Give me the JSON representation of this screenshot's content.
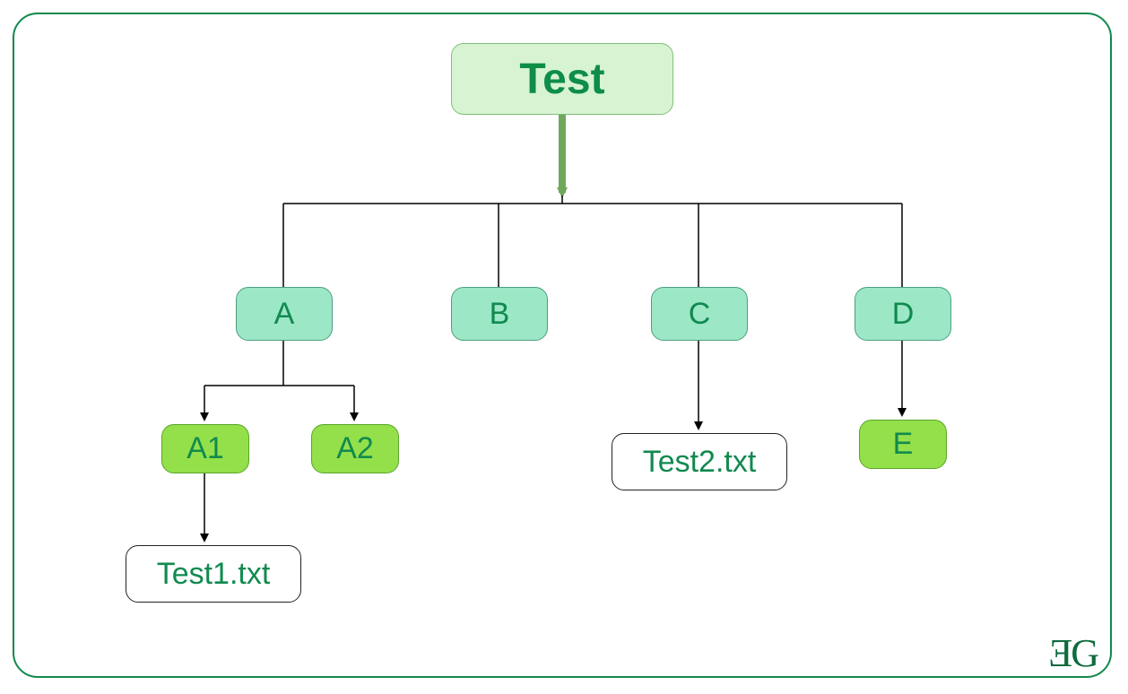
{
  "root": {
    "label": "Test"
  },
  "folders": {
    "a": "A",
    "b": "B",
    "c": "C",
    "d": "D"
  },
  "subfolders": {
    "a1": "A1",
    "a2": "A2",
    "e": "E"
  },
  "files": {
    "t1": "Test1.txt",
    "t2": "Test2.txt"
  },
  "logo": "ƎG",
  "colors": {
    "border_green": "#118a4f",
    "root_bg": "#d7f3d2",
    "folder_bg": "#9be7c6",
    "subfolder_bg": "#93e04a",
    "file_bg": "#ffffff",
    "text_green": "#118a4f",
    "arrow_green": "#6fa85b"
  },
  "chart_data": {
    "type": "tree",
    "title": "Test",
    "nodes": [
      {
        "id": "Test",
        "label": "Test",
        "kind": "root"
      },
      {
        "id": "A",
        "label": "A",
        "kind": "folder"
      },
      {
        "id": "B",
        "label": "B",
        "kind": "folder"
      },
      {
        "id": "C",
        "label": "C",
        "kind": "folder"
      },
      {
        "id": "D",
        "label": "D",
        "kind": "folder"
      },
      {
        "id": "A1",
        "label": "A1",
        "kind": "subfolder"
      },
      {
        "id": "A2",
        "label": "A2",
        "kind": "subfolder"
      },
      {
        "id": "E",
        "label": "E",
        "kind": "subfolder"
      },
      {
        "id": "Test1.txt",
        "label": "Test1.txt",
        "kind": "file"
      },
      {
        "id": "Test2.txt",
        "label": "Test2.txt",
        "kind": "file"
      }
    ],
    "edges": [
      {
        "from": "Test",
        "to": "A"
      },
      {
        "from": "Test",
        "to": "B"
      },
      {
        "from": "Test",
        "to": "C"
      },
      {
        "from": "Test",
        "to": "D"
      },
      {
        "from": "A",
        "to": "A1"
      },
      {
        "from": "A",
        "to": "A2"
      },
      {
        "from": "A1",
        "to": "Test1.txt"
      },
      {
        "from": "C",
        "to": "Test2.txt"
      },
      {
        "from": "D",
        "to": "E"
      }
    ]
  }
}
